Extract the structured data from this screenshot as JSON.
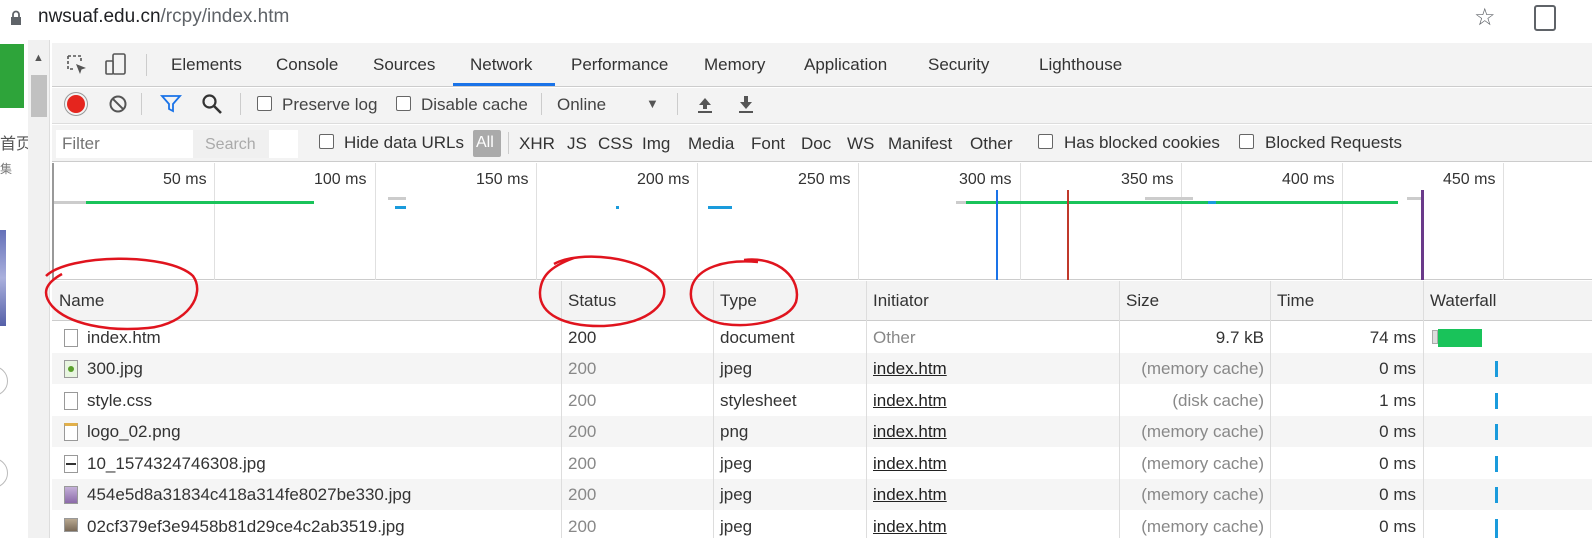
{
  "browser": {
    "url_host": "nwsuaf.edu.cn",
    "url_path": "/rcpy/index.htm",
    "star_icon": "☆"
  },
  "page_strip": {
    "text1": "首页",
    "text2": "集"
  },
  "tabs": [
    "Elements",
    "Console",
    "Sources",
    "Network",
    "Performance",
    "Memory",
    "Application",
    "Security",
    "Lighthouse"
  ],
  "active_tab": "Network",
  "toolbar": {
    "preserve_log": "Preserve log",
    "disable_cache": "Disable cache",
    "throttle": "Online"
  },
  "filterbar": {
    "filter_placeholder": "Filter",
    "search_hint": "Search",
    "hide_data_urls": "Hide data URLs",
    "all": "All",
    "types": [
      "XHR",
      "JS",
      "CSS",
      "Img",
      "Media",
      "Font",
      "Doc",
      "WS",
      "Manifest",
      "Other"
    ],
    "has_blocked_cookies": "Has blocked cookies",
    "blocked_requests": "Blocked Requests"
  },
  "overview": {
    "ticks": [
      "50 ms",
      "100 ms",
      "150 ms",
      "200 ms",
      "250 ms",
      "300 ms",
      "350 ms",
      "400 ms",
      "450 ms"
    ]
  },
  "table": {
    "columns": [
      "Name",
      "Status",
      "Type",
      "Initiator",
      "Size",
      "Time",
      "Waterfall"
    ],
    "rows": [
      {
        "name": "index.htm",
        "status": "200",
        "type": "document",
        "initiator": "Other",
        "size": "9.7 kB",
        "time": "74 ms"
      },
      {
        "name": "300.jpg",
        "status": "200",
        "type": "jpeg",
        "initiator": "index.htm",
        "size": "(memory cache)",
        "time": "0 ms"
      },
      {
        "name": "style.css",
        "status": "200",
        "type": "stylesheet",
        "initiator": "index.htm",
        "size": "(disk cache)",
        "time": "1 ms"
      },
      {
        "name": "logo_02.png",
        "status": "200",
        "type": "png",
        "initiator": "index.htm",
        "size": "(memory cache)",
        "time": "0 ms"
      },
      {
        "name": "10_1574324746308.jpg",
        "status": "200",
        "type": "jpeg",
        "initiator": "index.htm",
        "size": "(memory cache)",
        "time": "0 ms"
      },
      {
        "name": "454e5d8a31834c418a314fe8027be330.jpg",
        "status": "200",
        "type": "jpeg",
        "initiator": "index.htm",
        "size": "(memory cache)",
        "time": "0 ms"
      },
      {
        "name": "02cf379ef3e9458b81d29ce4c2ab3519.jpg",
        "status": "200",
        "type": "jpeg",
        "initiator": "index.htm",
        "size": "(memory cache)",
        "time": "0 ms"
      }
    ]
  },
  "colors": {
    "accent": "#1a73e8",
    "record": "#e5251e",
    "waterfall": "#1a9bdc",
    "annotation": "#e0141e"
  }
}
